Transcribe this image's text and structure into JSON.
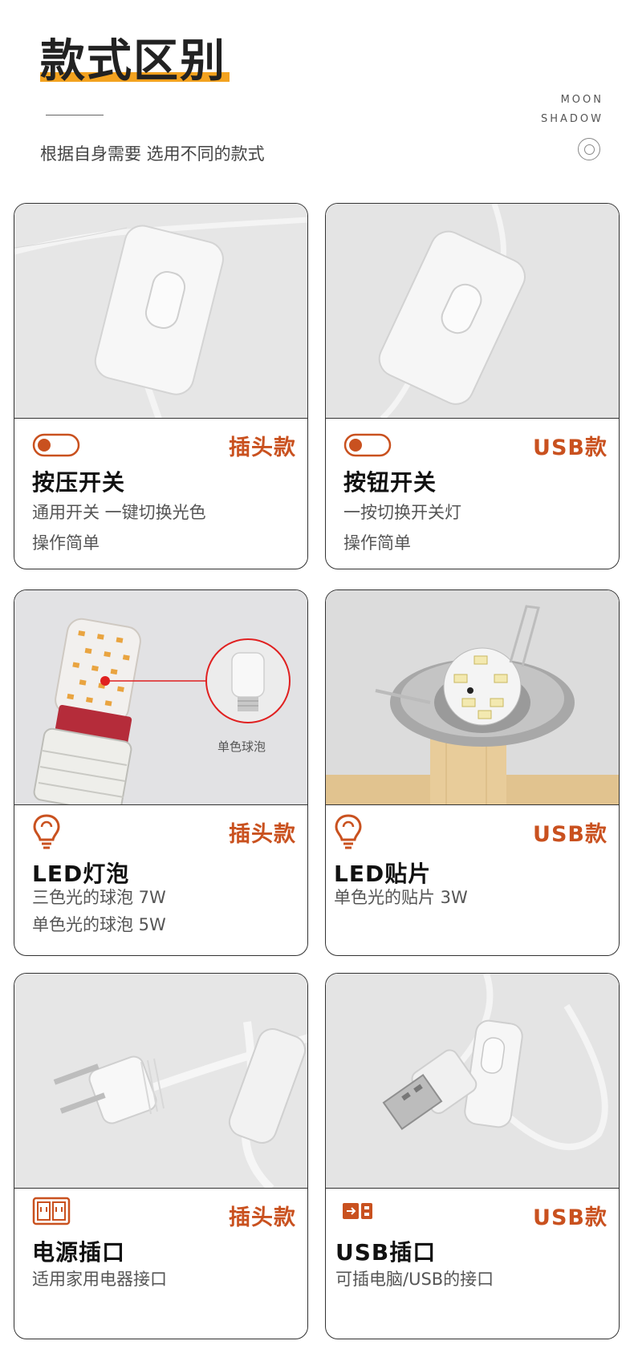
{
  "header": {
    "title": "款式区别",
    "subtitle": "根据自身需要 选用不同的款式",
    "brand_line1": "MOON",
    "brand_line2": "SHADOW"
  },
  "cards": [
    {
      "tag": "插头款",
      "title": "按压开关",
      "desc1": "通用开关 一键切换光色",
      "desc2": "操作简单",
      "icon": "toggle-switch-icon"
    },
    {
      "tag": "USB款",
      "title": "按钮开关",
      "desc1": "一按切换开关灯",
      "desc2": "操作简单",
      "icon": "toggle-switch-icon"
    },
    {
      "tag": "插头款",
      "title": "LED灯泡",
      "desc1": "三色光的球泡 7W",
      "desc2": "单色光的球泡 5W",
      "icon": "light-bulb-icon",
      "photo_label": "单色球泡"
    },
    {
      "tag": "USB款",
      "title": "LED贴片",
      "desc1": "单色光的贴片 3W",
      "icon": "light-bulb-icon"
    },
    {
      "tag": "插头款",
      "title": "电源插口",
      "desc1": "适用家用电器接口",
      "icon": "power-socket-icon"
    },
    {
      "tag": "USB款",
      "title": "USB插口",
      "desc1": "可插电脑/USB的接口",
      "icon": "usb-port-icon"
    }
  ],
  "colors": {
    "accent": "#c9511f",
    "title_bar": "#f3a21f",
    "border": "#333333"
  }
}
